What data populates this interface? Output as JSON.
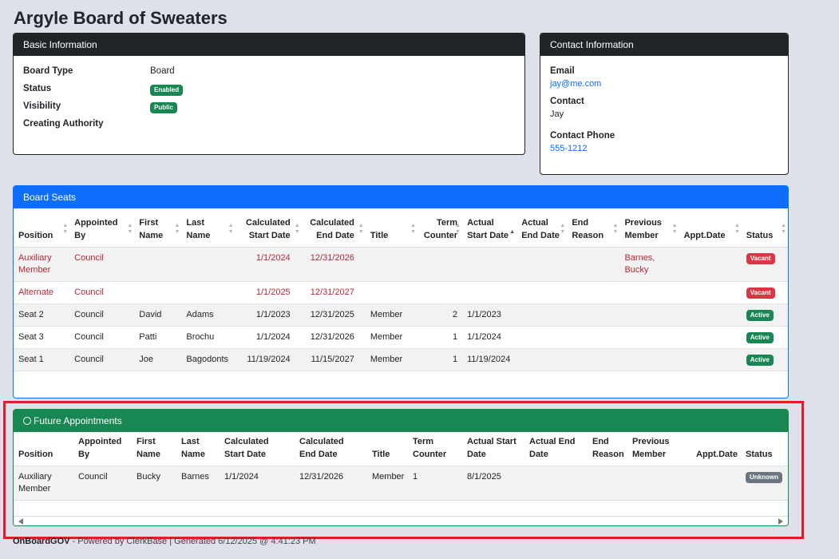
{
  "page": {
    "title": "Argyle Board of Sweaters"
  },
  "basic_info": {
    "header": "Basic Information",
    "board_type_label": "Board Type",
    "board_type_value": "Board",
    "status_label": "Status",
    "status_value": "Enabled",
    "visibility_label": "Visibility",
    "visibility_value": "Public",
    "authority_label": "Creating Authority"
  },
  "contact_info": {
    "header": "Contact Information",
    "email_label": "Email",
    "email_value": "jay@me.com",
    "contact_label": "Contact",
    "contact_value": "Jay",
    "phone_label": "Contact Phone",
    "phone_value": "555-1212"
  },
  "board_seats": {
    "header": "Board Seats",
    "columns": [
      "Position",
      "Appointed By",
      "First Name",
      "Last Name",
      "Calculated Start Date",
      "Calculated End Date",
      "Title",
      "Term Counter",
      "Actual Start Date",
      "Actual End Date",
      "End Reason",
      "Previous Member",
      "Appt.Date",
      "Status"
    ],
    "rows": [
      {
        "position": "Auxiliary Member",
        "appointed_by": "Council",
        "first": "",
        "last": "",
        "calc_start": "1/1/2024",
        "calc_end": "12/31/2026",
        "title": "",
        "term": "",
        "actual_start": "",
        "actual_end": "",
        "end_reason": "",
        "previous": "Barnes, Bucky",
        "appt_date": "",
        "status": "Vacant"
      },
      {
        "position": "Alternate",
        "appointed_by": "Council",
        "first": "",
        "last": "",
        "calc_start": "1/1/2025",
        "calc_end": "12/31/2027",
        "title": "",
        "term": "",
        "actual_start": "",
        "actual_end": "",
        "end_reason": "",
        "previous": "",
        "appt_date": "",
        "status": "Vacant"
      },
      {
        "position": "Seat 2",
        "appointed_by": "Council",
        "first": "David",
        "last": "Adams",
        "calc_start": "1/1/2023",
        "calc_end": "12/31/2025",
        "title": "Member",
        "term": "2",
        "actual_start": "1/1/2023",
        "actual_end": "",
        "end_reason": "",
        "previous": "",
        "appt_date": "",
        "status": "Active"
      },
      {
        "position": "Seat 3",
        "appointed_by": "Council",
        "first": "Patti",
        "last": "Brochu",
        "calc_start": "1/1/2024",
        "calc_end": "12/31/2026",
        "title": "Member",
        "term": "1",
        "actual_start": "1/1/2024",
        "actual_end": "",
        "end_reason": "",
        "previous": "",
        "appt_date": "",
        "status": "Active"
      },
      {
        "position": "Seat 1",
        "appointed_by": "Council",
        "first": "Joe",
        "last": "Bagodonts",
        "calc_start": "11/19/2024",
        "calc_end": "11/15/2027",
        "title": "Member",
        "term": "1",
        "actual_start": "11/19/2024",
        "actual_end": "",
        "end_reason": "",
        "previous": "",
        "appt_date": "",
        "status": "Active"
      }
    ]
  },
  "future_appointments": {
    "header": "Future Appointments",
    "columns": [
      "Position",
      "Appointed By",
      "First Name",
      "Last Name",
      "Calculated Start Date",
      "Calculated End Date",
      "Title",
      "Term Counter",
      "Actual Start Date",
      "Actual End Date",
      "End Reason",
      "Previous Member",
      "Appt.Date",
      "Status"
    ],
    "rows": [
      {
        "position": "Auxiliary Member",
        "appointed_by": "Council",
        "first": "Bucky",
        "last": "Barnes",
        "calc_start": "1/1/2024",
        "calc_end": "12/31/2026",
        "title": "Member",
        "term": "1",
        "actual_start": "8/1/2025",
        "actual_end": "",
        "end_reason": "",
        "previous": "",
        "appt_date": "",
        "status": "Unknown"
      }
    ]
  },
  "footer": {
    "brand": "OnBoardGOV",
    "text": " - Powered by ClerkBase | Generated 6/12/2025 @ 4:41:23 PM"
  },
  "colors": {
    "highlight": "#e11d2a",
    "vacant": "#dc3545",
    "active": "#198754",
    "unknown": "#6c757d"
  }
}
